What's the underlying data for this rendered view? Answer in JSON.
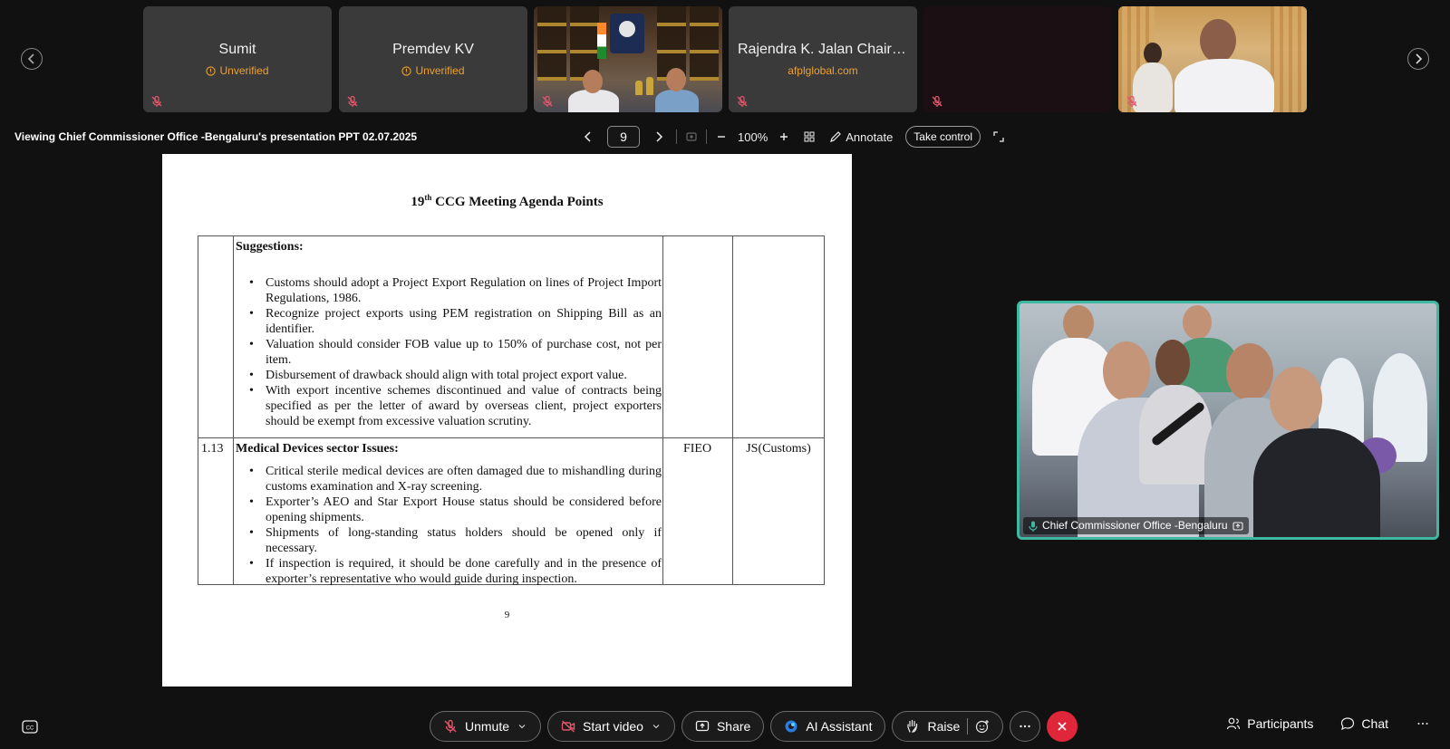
{
  "participants": [
    {
      "name": "Sumit",
      "status": "Unverified"
    },
    {
      "name": "Premdev KV",
      "status": "Unverified"
    },
    {
      "name": "",
      "status": ""
    },
    {
      "name": "Rajendra K. Jalan Chairman...",
      "status": "afplglobal.com"
    },
    {
      "name": "",
      "status": ""
    },
    {
      "name": "",
      "status": ""
    }
  ],
  "presentation": {
    "viewing_text": "Viewing Chief Commissioner Office -Bengaluru's presentation PPT 02.07.2025",
    "page": "9",
    "zoom": "100%",
    "annotate_label": "Annotate",
    "take_control_label": "Take control"
  },
  "slide": {
    "title_prefix": "19",
    "title_sup": "th",
    "title_rest": " CCG Meeting Agenda Points",
    "row1": {
      "heading": "Suggestions:",
      "bullets": [
        "Customs should adopt a Project Export Regulation on lines of Project Import Regulations, 1986.",
        "Recognize project exports using PEM registration on Shipping Bill as an identifier.",
        "Valuation should consider FOB value up to 150% of purchase cost, not per item.",
        "Disbursement of drawback should align with total project export value.",
        "With export incentive schemes discontinued and value of contracts being specified as per the letter of award by overseas client, project exporters should be exempt from excessive valuation scrutiny."
      ]
    },
    "row2": {
      "number": "1.13",
      "heading": "Medical Devices sector Issues:",
      "raised_by": "FIEO",
      "responsible": "JS(Customs)",
      "bullets": [
        "Critical sterile medical devices are often damaged due to mishandling during customs examination and X-ray screening.",
        "Exporter’s AEO and Star Export House status should be considered before opening shipments.",
        "Shipments of long-standing status holders should be opened only if necessary.",
        "If inspection is required, it should be done carefully and in the presence of exporter’s representative who would guide during inspection."
      ]
    },
    "page_number": "9"
  },
  "self_view": {
    "label": "Chief Commissioner Office -Bengaluru",
    "border_color": "#3fb8a0"
  },
  "controls": {
    "unmute": "Unmute",
    "start_video": "Start video",
    "share": "Share",
    "ai_assistant": "AI Assistant",
    "raise": "Raise",
    "participants": "Participants",
    "chat": "Chat",
    "end_call_color": "#e0263a"
  },
  "colors": {
    "background": "#111111",
    "tile": "#3a3a3a",
    "unverified": "#f0a030"
  }
}
